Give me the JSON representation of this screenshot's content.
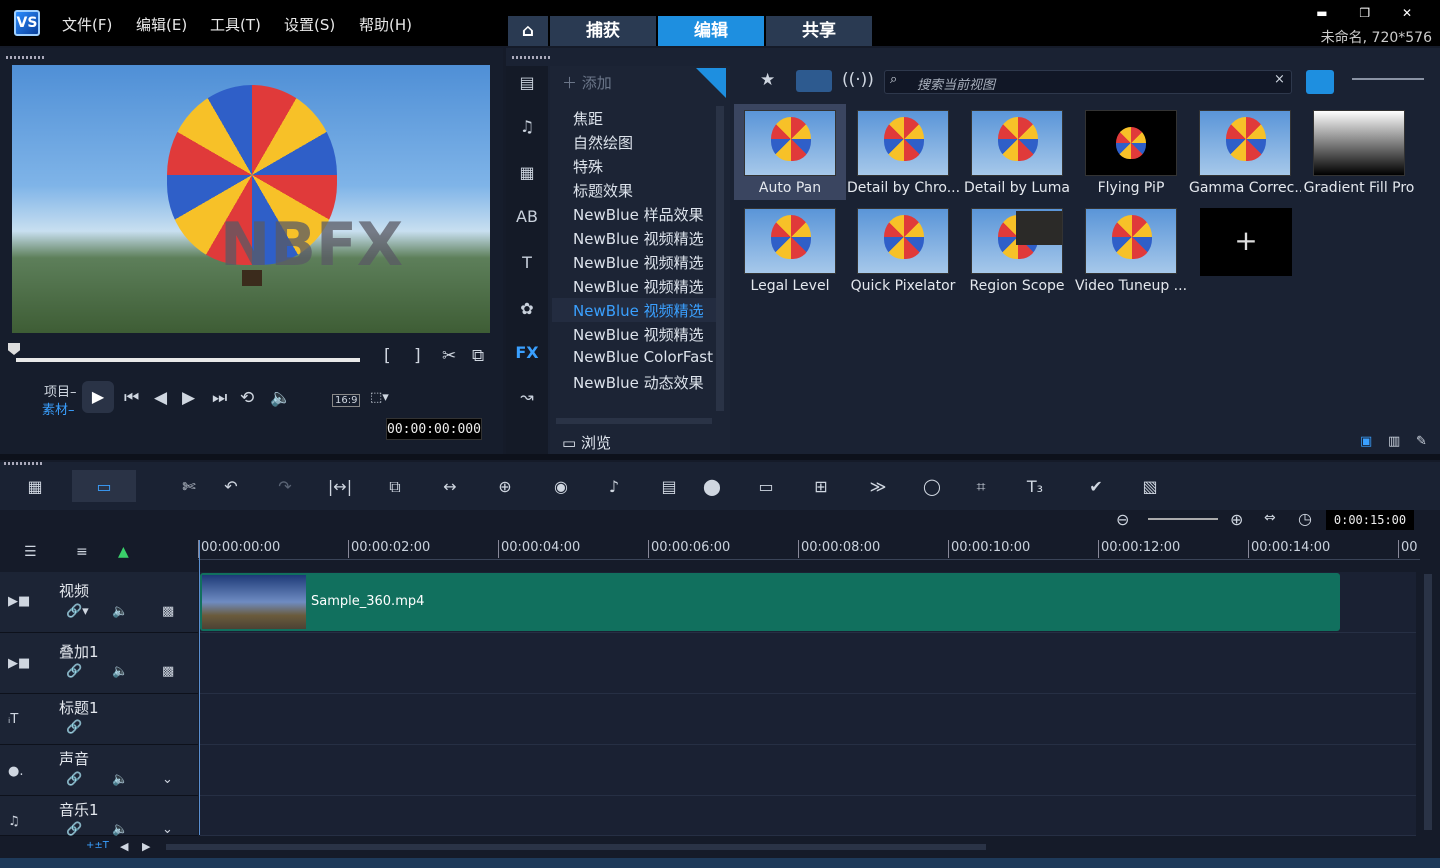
{
  "app": {
    "logo_text": "VS",
    "menus": [
      "文件(F)",
      "编辑(E)",
      "工具(T)",
      "设置(S)",
      "帮助(H)"
    ],
    "tabs": {
      "home_icon": "home-icon",
      "capture": "捕获",
      "edit": "编辑",
      "share": "共享"
    },
    "window_controls": "▬ ❐ ✕",
    "project_info": "未命名, 720*576"
  },
  "player": {
    "watermark": "NBFX",
    "mode_project": "项目–",
    "mode_clip": "素材–",
    "aspect": "16:9",
    "timecode": "00:00:00:000"
  },
  "library": {
    "add_label": "添加",
    "categories": [
      "焦距",
      "自然绘图",
      "特殊",
      "标题效果",
      "NewBlue 样品效果",
      "NewBlue 视频精选",
      "NewBlue 视频精选",
      "NewBlue 视频精选",
      "NewBlue 视频精选",
      "NewBlue 视频精选",
      "NewBlue ColorFast",
      "NewBlue 动态效果"
    ],
    "browse_label": "浏览",
    "search_placeholder": "搜索当前视图",
    "sidebar_fx": "FX",
    "thumbnails": [
      "Auto Pan",
      "Detail by Chro...",
      "Detail by Luma",
      "Flying PiP",
      "Gamma Correc...",
      "Gradient Fill Pro",
      "Legal Level",
      "Quick Pixelator",
      "Region Scope",
      "Video Tuneup ..."
    ],
    "add_thumb_label": "+"
  },
  "timeline": {
    "project_time": "0:00:15:00",
    "ruler": [
      "00:00:00:00",
      "00:00:02:00",
      "00:00:04:00",
      "00:00:06:00",
      "00:00:08:00",
      "00:00:10:00",
      "00:00:12:00",
      "00:00:14:00",
      "00"
    ],
    "tracks": [
      {
        "name": "视频"
      },
      {
        "name": "叠加1"
      },
      {
        "name": "标题1"
      },
      {
        "name": "声音"
      },
      {
        "name": "音乐1"
      }
    ],
    "clip_name": "Sample_360.mp4"
  },
  "colors": {
    "accent": "#1e8fe0",
    "clip": "#11705e",
    "background": "#151b29"
  }
}
